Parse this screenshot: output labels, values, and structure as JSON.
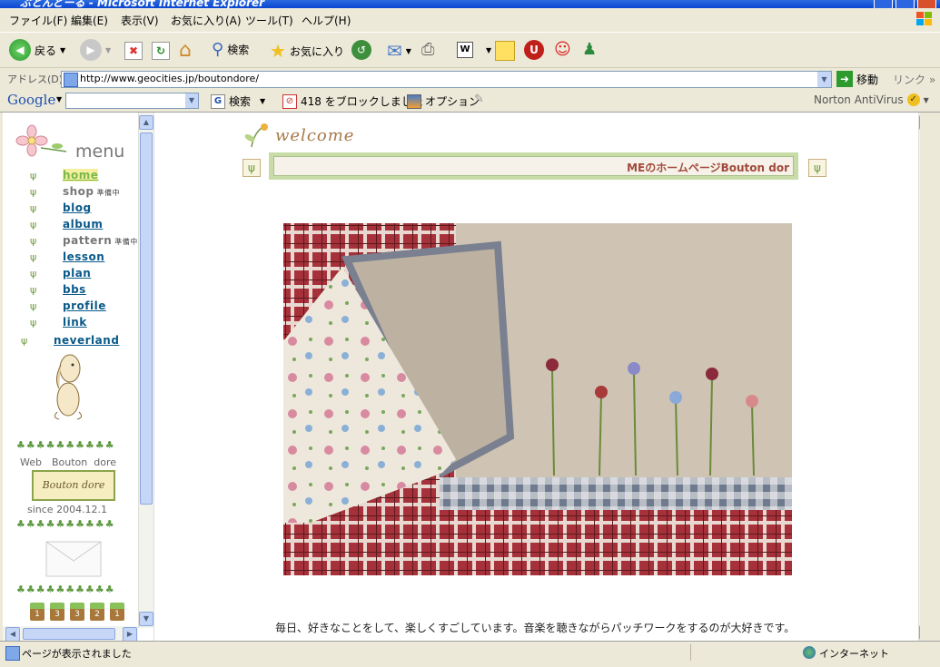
{
  "window": {
    "title": "ぶとんどーる - Microsoft Internet Explorer"
  },
  "menubar": {
    "items": [
      "ファイル(F)",
      "編集(E)",
      "表示(V)",
      "お気に入り(A)",
      "ツール(T)",
      "ヘルプ(H)"
    ]
  },
  "toolbar": {
    "back_label": "戻る",
    "search_label": "検索",
    "favorites_label": "お気に入り"
  },
  "address": {
    "label": "アドレス(D)",
    "url": "http://www.geocities.jp/boutondore/",
    "go_label": "移動",
    "links_label": "リンク"
  },
  "google": {
    "logo": "Google",
    "search_label": "検索",
    "blocked_label": "418 をブロックしました",
    "options_label": "オプション",
    "norton_label": "Norton AntiVirus"
  },
  "sidebar": {
    "menu_title": "menu",
    "items": [
      {
        "label": "home",
        "soon": ""
      },
      {
        "label": "shop",
        "soon": "準備中"
      },
      {
        "label": "blog",
        "soon": ""
      },
      {
        "label": "album",
        "soon": ""
      },
      {
        "label": "pattern",
        "soon": "準備中"
      },
      {
        "label": "lesson",
        "soon": ""
      },
      {
        "label": "plan",
        "soon": ""
      },
      {
        "label": "bbs",
        "soon": ""
      },
      {
        "label": "profile",
        "soon": ""
      },
      {
        "label": "link",
        "soon": ""
      },
      {
        "label": "neverland",
        "soon": ""
      }
    ],
    "web_label": "Web　Bouton  dore",
    "badge_text": "Bouton dore",
    "since_label": "since 2004.12.1",
    "pot_numbers": [
      "1",
      "3",
      "3",
      "2",
      "1"
    ]
  },
  "main": {
    "welcome": "welcome",
    "marquee": "MEのホームページBouton dor",
    "caption": "毎日、好きなことをして、楽しくすごしています。音楽を聴きながらパッチワークをするのが大好きです。"
  },
  "status": {
    "text": "ページが表示されました",
    "zone": "インターネット"
  }
}
